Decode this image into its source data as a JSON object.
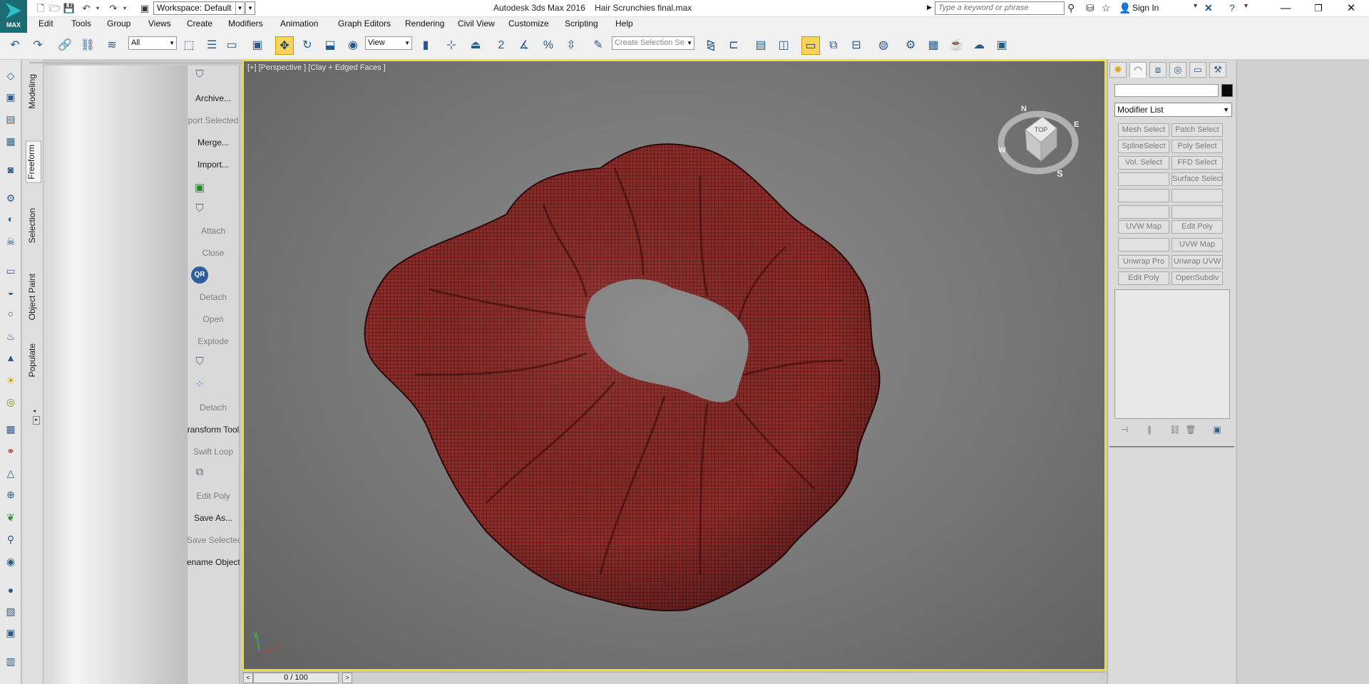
{
  "app": {
    "logo_text": "MAX",
    "workspace_label": "Workspace: Default",
    "title": "Autodesk 3ds Max 2016    Hair Scrunchies final.max",
    "search_placeholder": "Type a keyword or phrase",
    "sign_in": "Sign In"
  },
  "menu": [
    "Edit",
    "Tools",
    "Group",
    "Views",
    "Create",
    "Modifiers",
    "Animation",
    "Graph Editors",
    "Rendering",
    "Civil View",
    "Customize",
    "Scripting",
    "Help"
  ],
  "toolbar": {
    "selection_filter": "All",
    "ref_coord": "View",
    "snap_label": "2",
    "selection_set_placeholder": "Create Selection Se"
  },
  "ribbon_tabs": [
    "Modeling",
    "Freeform",
    "Selection",
    "Object Paint",
    "Populate"
  ],
  "tool_panel": [
    {
      "label": "Archive...",
      "dim": false
    },
    {
      "label": "port Selected",
      "dim": true
    },
    {
      "label": "Merge...",
      "dim": false
    },
    {
      "label": "Import...",
      "dim": false
    },
    {
      "label": "Attach",
      "dim": true
    },
    {
      "label": "Close",
      "dim": true
    },
    {
      "label": "Detach",
      "dim": true
    },
    {
      "label": "Open",
      "dim": true
    },
    {
      "label": "Explode",
      "dim": true
    },
    {
      "label": "Detach",
      "dim": true
    },
    {
      "label": "ransform Tool",
      "dim": false
    },
    {
      "label": "Swift Loop",
      "dim": true
    },
    {
      "label": "Edit Poly",
      "dim": true
    },
    {
      "label": "Save As...",
      "dim": false
    },
    {
      "label": "Save Selected",
      "dim": true
    },
    {
      "label": "ename Objects",
      "dim": false
    }
  ],
  "viewport": {
    "label": "[+] [Perspective ] [Clay + Edged Faces ]",
    "viewcube_top": "TOP",
    "compass": {
      "n": "N",
      "e": "E",
      "s": "S",
      "w": "W"
    },
    "axis": {
      "x": "x",
      "y": "y",
      "z": "z"
    },
    "mesh_color": "#8e2d2b",
    "wire_color": "#2a0706"
  },
  "timeline": {
    "frame": "0 / 100"
  },
  "command_panel": {
    "modifier_list": "Modifier List",
    "buttons": [
      "Mesh Select",
      "Patch Select",
      "SplineSelect",
      "Poly Select",
      "Vol. Select",
      "FFD Select",
      "",
      "Surface Select",
      "",
      "",
      "",
      "",
      "UVW Map",
      "Edit Poly",
      "",
      "UVW Map",
      "Unwrap Pro",
      "Unwrap UVW",
      "Edit Poly",
      "OpenSubdiv"
    ]
  },
  "colors": {
    "accent": "#f2e32a",
    "highlight_btn": "#f6d45b"
  }
}
